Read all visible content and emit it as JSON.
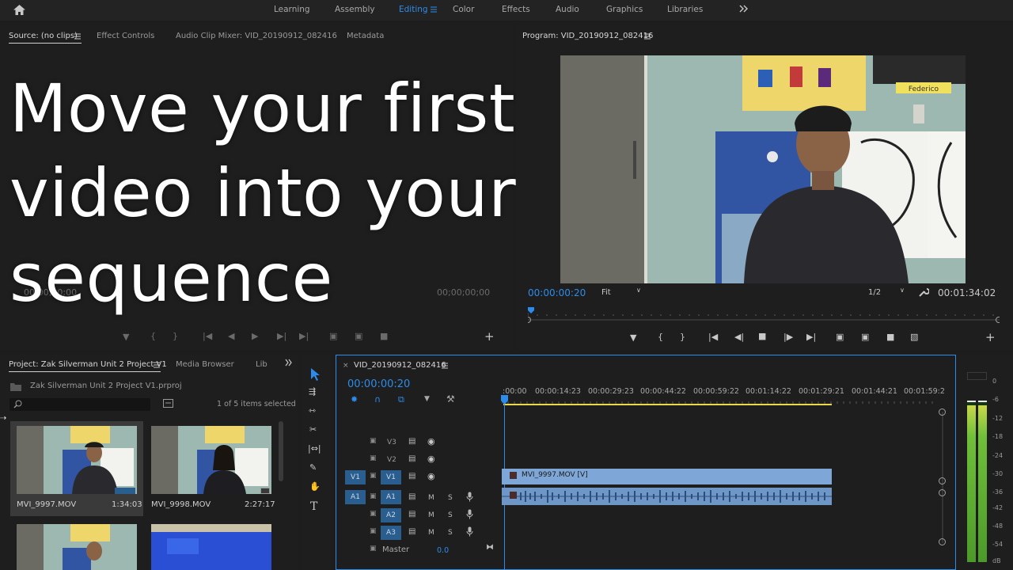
{
  "workspaces": [
    "Learning",
    "Assembly",
    "Editing",
    "Color",
    "Effects",
    "Audio",
    "Graphics",
    "Libraries"
  ],
  "active_workspace": "Editing",
  "source_panel": {
    "tabs": [
      "Source: (no clips)",
      "Effect Controls",
      "Audio Clip Mixer: VID_20190912_082416",
      "Metadata"
    ],
    "timecode_left": "00;00;00;00",
    "timecode_right": "00;00;00;00"
  },
  "overlay_text": [
    "Move your first",
    "video into your",
    "sequence"
  ],
  "program_panel": {
    "title": "Program: VID_20190912_082416",
    "timecode": "00:00:00:20",
    "fit": "Fit",
    "resolution": "1/2",
    "duration": "00:01:34:02",
    "poster_name": "Federico"
  },
  "project_panel": {
    "tabs": [
      "Project: Zak Silverman Unit 2 Project V1",
      "Media Browser",
      "Lib"
    ],
    "file": "Zak Silverman Unit 2 Project V1.prproj",
    "selection": "1 of 5 items selected",
    "items": [
      {
        "name": "MVI_9997.MOV",
        "duration": "1:34:03"
      },
      {
        "name": "MVI_9998.MOV",
        "duration": "2:27:17"
      }
    ]
  },
  "timeline": {
    "sequence": "VID_20190912_082416",
    "timecode": "00:00:00:20",
    "ruler": [
      ":00:00",
      "00:00:14:23",
      "00:00:29:23",
      "00:00:44:22",
      "00:00:59:22",
      "00:01:14:22",
      "00:01:29:21",
      "00:01:44:21",
      "00:01:59:2"
    ],
    "video_tracks": [
      "V3",
      "V2",
      "V1"
    ],
    "audio_tracks": [
      "A1",
      "A2",
      "A3"
    ],
    "source_v": "V1",
    "source_a": "A1",
    "master_label": "Master",
    "master_value": "0.0",
    "clip_label": "MVI_9997.MOV [V]",
    "mute": "M",
    "solo": "S"
  },
  "meter_scale": [
    "0",
    "-6",
    "-12",
    "-18",
    "-24",
    "-30",
    "-36",
    "-42",
    "-48",
    "-54",
    "dB"
  ],
  "colors": {
    "accent": "#2d8ceb",
    "clip_video": "#7ea6d6",
    "clip_audio": "#6e97c8",
    "meter_green": "#6fbf3a"
  }
}
